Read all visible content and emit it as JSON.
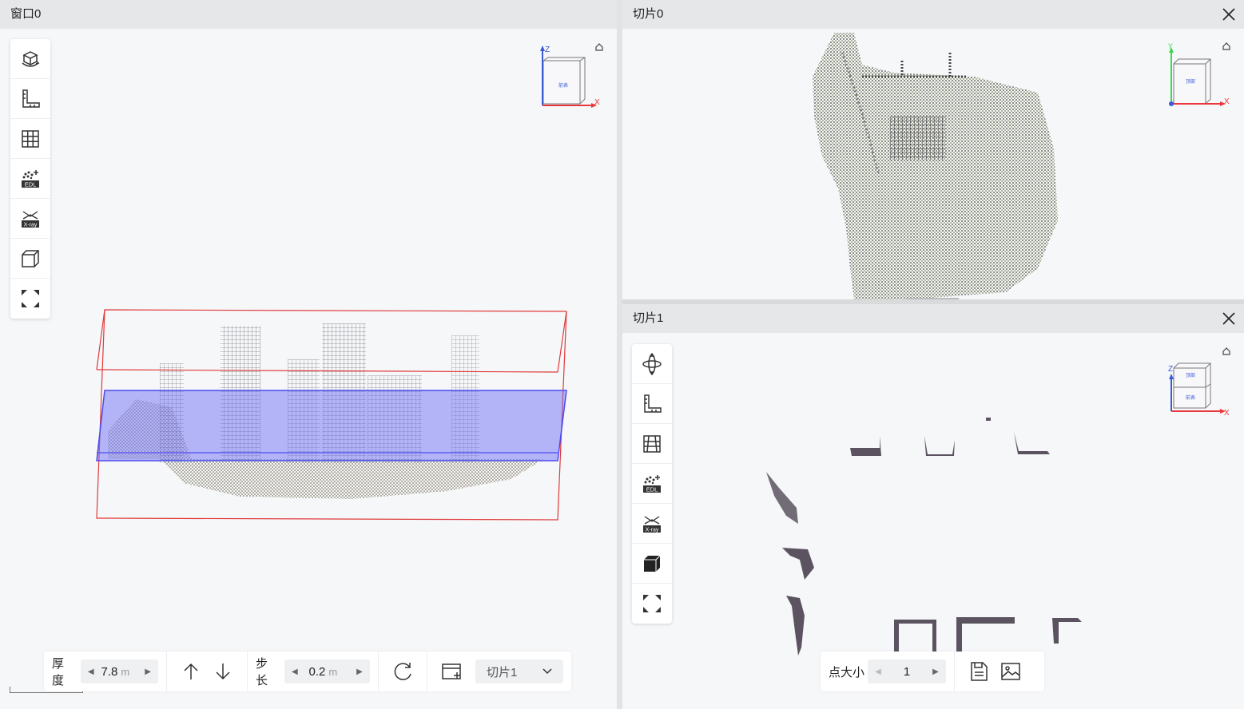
{
  "window0": {
    "title": "窗口0",
    "thickness_label": "厚度",
    "thickness_value": "7.8",
    "thickness_unit": "m",
    "step_label": "步长",
    "step_value": "0.2",
    "step_unit": "m",
    "slice_select_value": "切片1",
    "gizmo": {
      "axis_z": "Z",
      "axis_x": "X",
      "face": "前表"
    }
  },
  "slice0": {
    "title": "切片0",
    "gizmo": {
      "axis_y": "Y",
      "axis_x": "X",
      "face": "顶部"
    }
  },
  "slice1": {
    "title": "切片1",
    "point_size_label": "点大小",
    "point_size_value": "1",
    "gizmo": {
      "axis_z": "Z",
      "axis_x": "X",
      "face_top": "顶部",
      "face_front": "前表"
    }
  },
  "colors": {
    "bbox_red": "#e03a3a",
    "slice_plane": "#6f6ff5",
    "axis_x": "#e8383d",
    "axis_z": "#3a5bd8",
    "axis_y": "#3ad84a"
  },
  "icons": [
    "rotate-cube-icon",
    "ruler-icon",
    "grid-icon",
    "edl-icon",
    "xray-icon",
    "box-icon",
    "fullscreen-icon",
    "orbit-icon",
    "arrow-up-icon",
    "arrow-down-icon",
    "refresh-icon",
    "add-slice-icon",
    "chevron-down-icon",
    "save-icon",
    "image-icon",
    "close-icon",
    "home-icon"
  ]
}
